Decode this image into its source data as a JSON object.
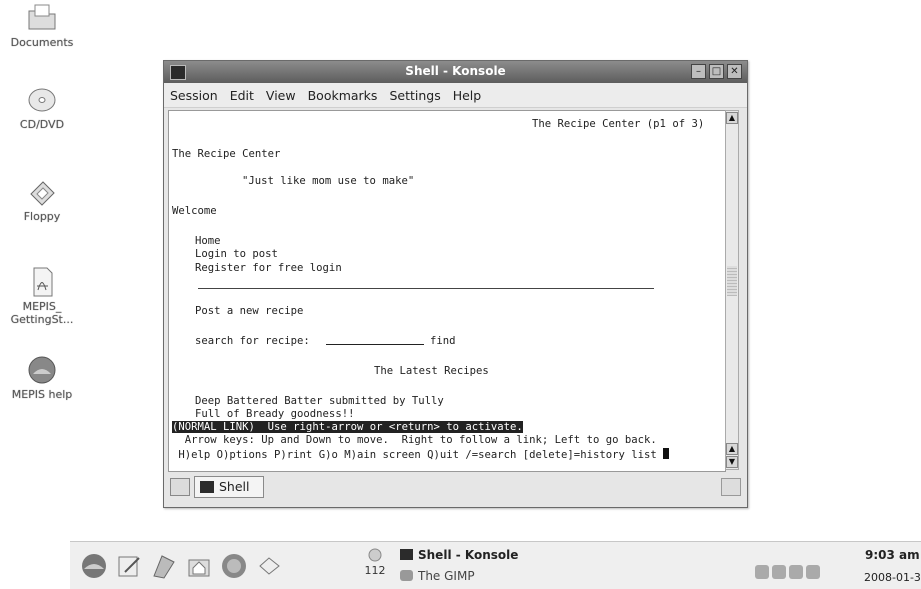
{
  "desktop": {
    "icons": [
      {
        "label": "Documents",
        "icon": "folder-icon"
      },
      {
        "label": "CD/DVD",
        "icon": "cd-icon"
      },
      {
        "label": "Floppy",
        "icon": "floppy-icon"
      },
      {
        "label": "MEPIS_\nGettingSt...",
        "icon": "pdf-icon"
      },
      {
        "label": "MEPIS help",
        "icon": "help-icon"
      }
    ]
  },
  "window": {
    "title": "Shell - Konsole",
    "menu": [
      "Session",
      "Edit",
      "View",
      "Bookmarks",
      "Settings",
      "Help"
    ],
    "tab_label": "Shell"
  },
  "terminal": {
    "header": "The Recipe Center (p1 of 3)",
    "site_name": "The Recipe Center",
    "tagline": "\"Just like mom use to make\"",
    "welcome": "Welcome",
    "links": [
      "Home",
      "Login to post",
      "Register for free login"
    ],
    "post_link": "Post a new recipe",
    "search_label": "search for recipe:",
    "search_button": "find",
    "latest_heading": "The Latest Recipes",
    "recipe_title": "Deep Battered Batter",
    "recipe_by": " submitted by Tully",
    "recipe_desc": "Full of Bready goodness!!",
    "status_line": "(NORMAL LINK)  Use right-arrow or <return> to activate.",
    "help_line1": "  Arrow keys: Up and Down to move.  Right to follow a link; Left to go back.",
    "help_line2": " H)elp O)ptions P)rint G)o M)ain screen Q)uit /=search [delete]=history list"
  },
  "taskbar": {
    "quick_launch": [
      "mepis-icon",
      "kate-icon",
      "kopete-icon",
      "home-folder-icon",
      "firefox-icon",
      "kontact-icon"
    ],
    "desktop_number": "112",
    "tasks": [
      "Shell - Konsole",
      "The GIMP"
    ],
    "tray": [
      "speaker-icon",
      "network-icon",
      "klipper-icon",
      "display-icon"
    ],
    "time": "9:03 am",
    "date": "2008-01-30"
  }
}
